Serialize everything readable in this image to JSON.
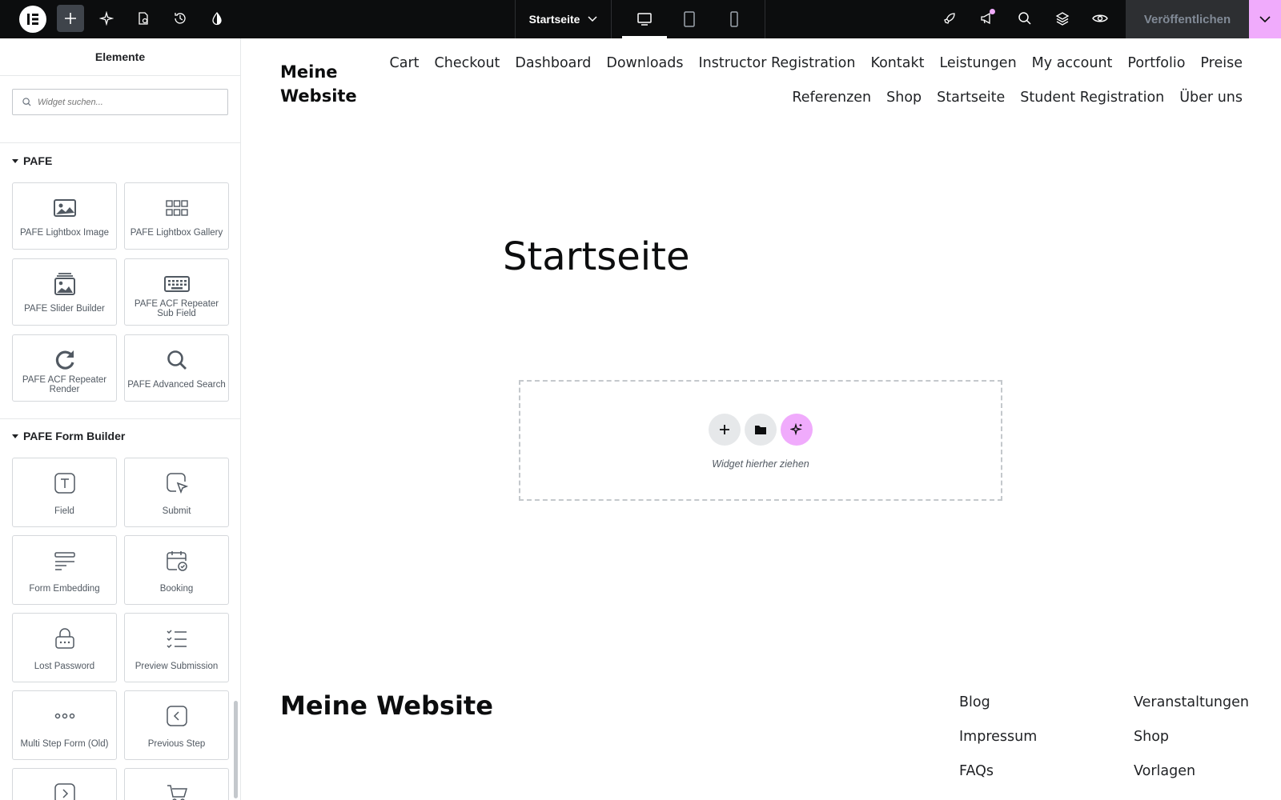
{
  "topbar": {
    "page_name": "Startseite",
    "publish_label": "Veröffentlichen",
    "colors": {
      "bar": "#0c0d0e",
      "accent": "#f0abfc"
    }
  },
  "panel": {
    "title": "Elemente",
    "search_placeholder": "Widget suchen...",
    "sections": [
      {
        "name": "PAFE",
        "widgets": [
          {
            "label": "PAFE Lightbox Image",
            "icon": "image-icon"
          },
          {
            "label": "PAFE Lightbox Gallery",
            "icon": "gallery-grid-icon"
          },
          {
            "label": "PAFE Slider Builder",
            "icon": "slider-image-icon"
          },
          {
            "label": "PAFE ACF Repeater Sub Field",
            "icon": "keyboard-icon"
          },
          {
            "label": "PAFE ACF Repeater Render",
            "icon": "refresh-icon"
          },
          {
            "label": "PAFE Advanced Search",
            "icon": "search-icon"
          }
        ]
      },
      {
        "name": "PAFE Form Builder",
        "widgets": [
          {
            "label": "Field",
            "icon": "text-field-icon"
          },
          {
            "label": "Submit",
            "icon": "cursor-click-icon"
          },
          {
            "label": "Form Embedding",
            "icon": "form-lines-icon"
          },
          {
            "label": "Booking",
            "icon": "calendar-check-icon"
          },
          {
            "label": "Lost Password",
            "icon": "lock-icon"
          },
          {
            "label": "Preview Submission",
            "icon": "checklist-icon"
          },
          {
            "label": "Multi Step Form (Old)",
            "icon": "dots-icon"
          },
          {
            "label": "Previous Step",
            "icon": "chevron-left-square-icon"
          },
          {
            "label": "",
            "icon": "chevron-right-square-icon"
          },
          {
            "label": "",
            "icon": "cart-icon"
          }
        ]
      }
    ]
  },
  "canvas": {
    "site_title": "Meine Website",
    "nav_row1": [
      "Cart",
      "Checkout",
      "Dashboard",
      "Downloads",
      "Instructor Registration",
      "Kontakt",
      "Leistungen",
      "My account",
      "Portfolio",
      "Preise"
    ],
    "nav_row2": [
      "Referenzen",
      "Shop",
      "Startseite",
      "Student Registration",
      "Über uns"
    ],
    "page_heading": "Startseite",
    "dropzone_text": "Widget hierher ziehen",
    "footer_title": "Meine Website",
    "footer_col1": [
      "Blog",
      "Impressum",
      "FAQs"
    ],
    "footer_col2": [
      "Veranstaltungen",
      "Shop",
      "Vorlagen"
    ]
  }
}
